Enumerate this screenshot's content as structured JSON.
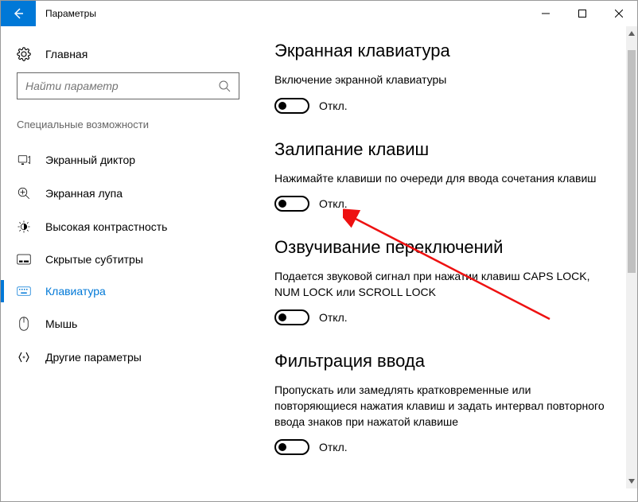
{
  "window": {
    "title": "Параметры"
  },
  "sidebar": {
    "home": "Главная",
    "search_placeholder": "Найти параметр",
    "section": "Специальные возможности",
    "items": [
      {
        "label": "Экранный диктор"
      },
      {
        "label": "Экранная лупа"
      },
      {
        "label": "Высокая контрастность"
      },
      {
        "label": "Скрытые субтитры"
      },
      {
        "label": "Клавиатура"
      },
      {
        "label": "Мышь"
      },
      {
        "label": "Другие параметры"
      }
    ]
  },
  "main": {
    "groups": [
      {
        "title": "Экранная клавиатура",
        "desc": "Включение экранной клавиатуры",
        "state": "Откл."
      },
      {
        "title": "Залипание клавиш",
        "desc": "Нажимайте клавиши по очереди для ввода сочетания клавиш",
        "state": "Откл."
      },
      {
        "title": "Озвучивание переключений",
        "desc": "Подается звуковой сигнал при нажатии клавиш CAPS LOCK, NUM LOCK или SCROLL LOCK",
        "state": "Откл."
      },
      {
        "title": "Фильтрация ввода",
        "desc": "Пропускать или замедлять кратковременные или повторяющиеся нажатия клавиш и задать интервал повторного ввода знаков при нажатой клавише",
        "state": "Откл."
      }
    ]
  }
}
